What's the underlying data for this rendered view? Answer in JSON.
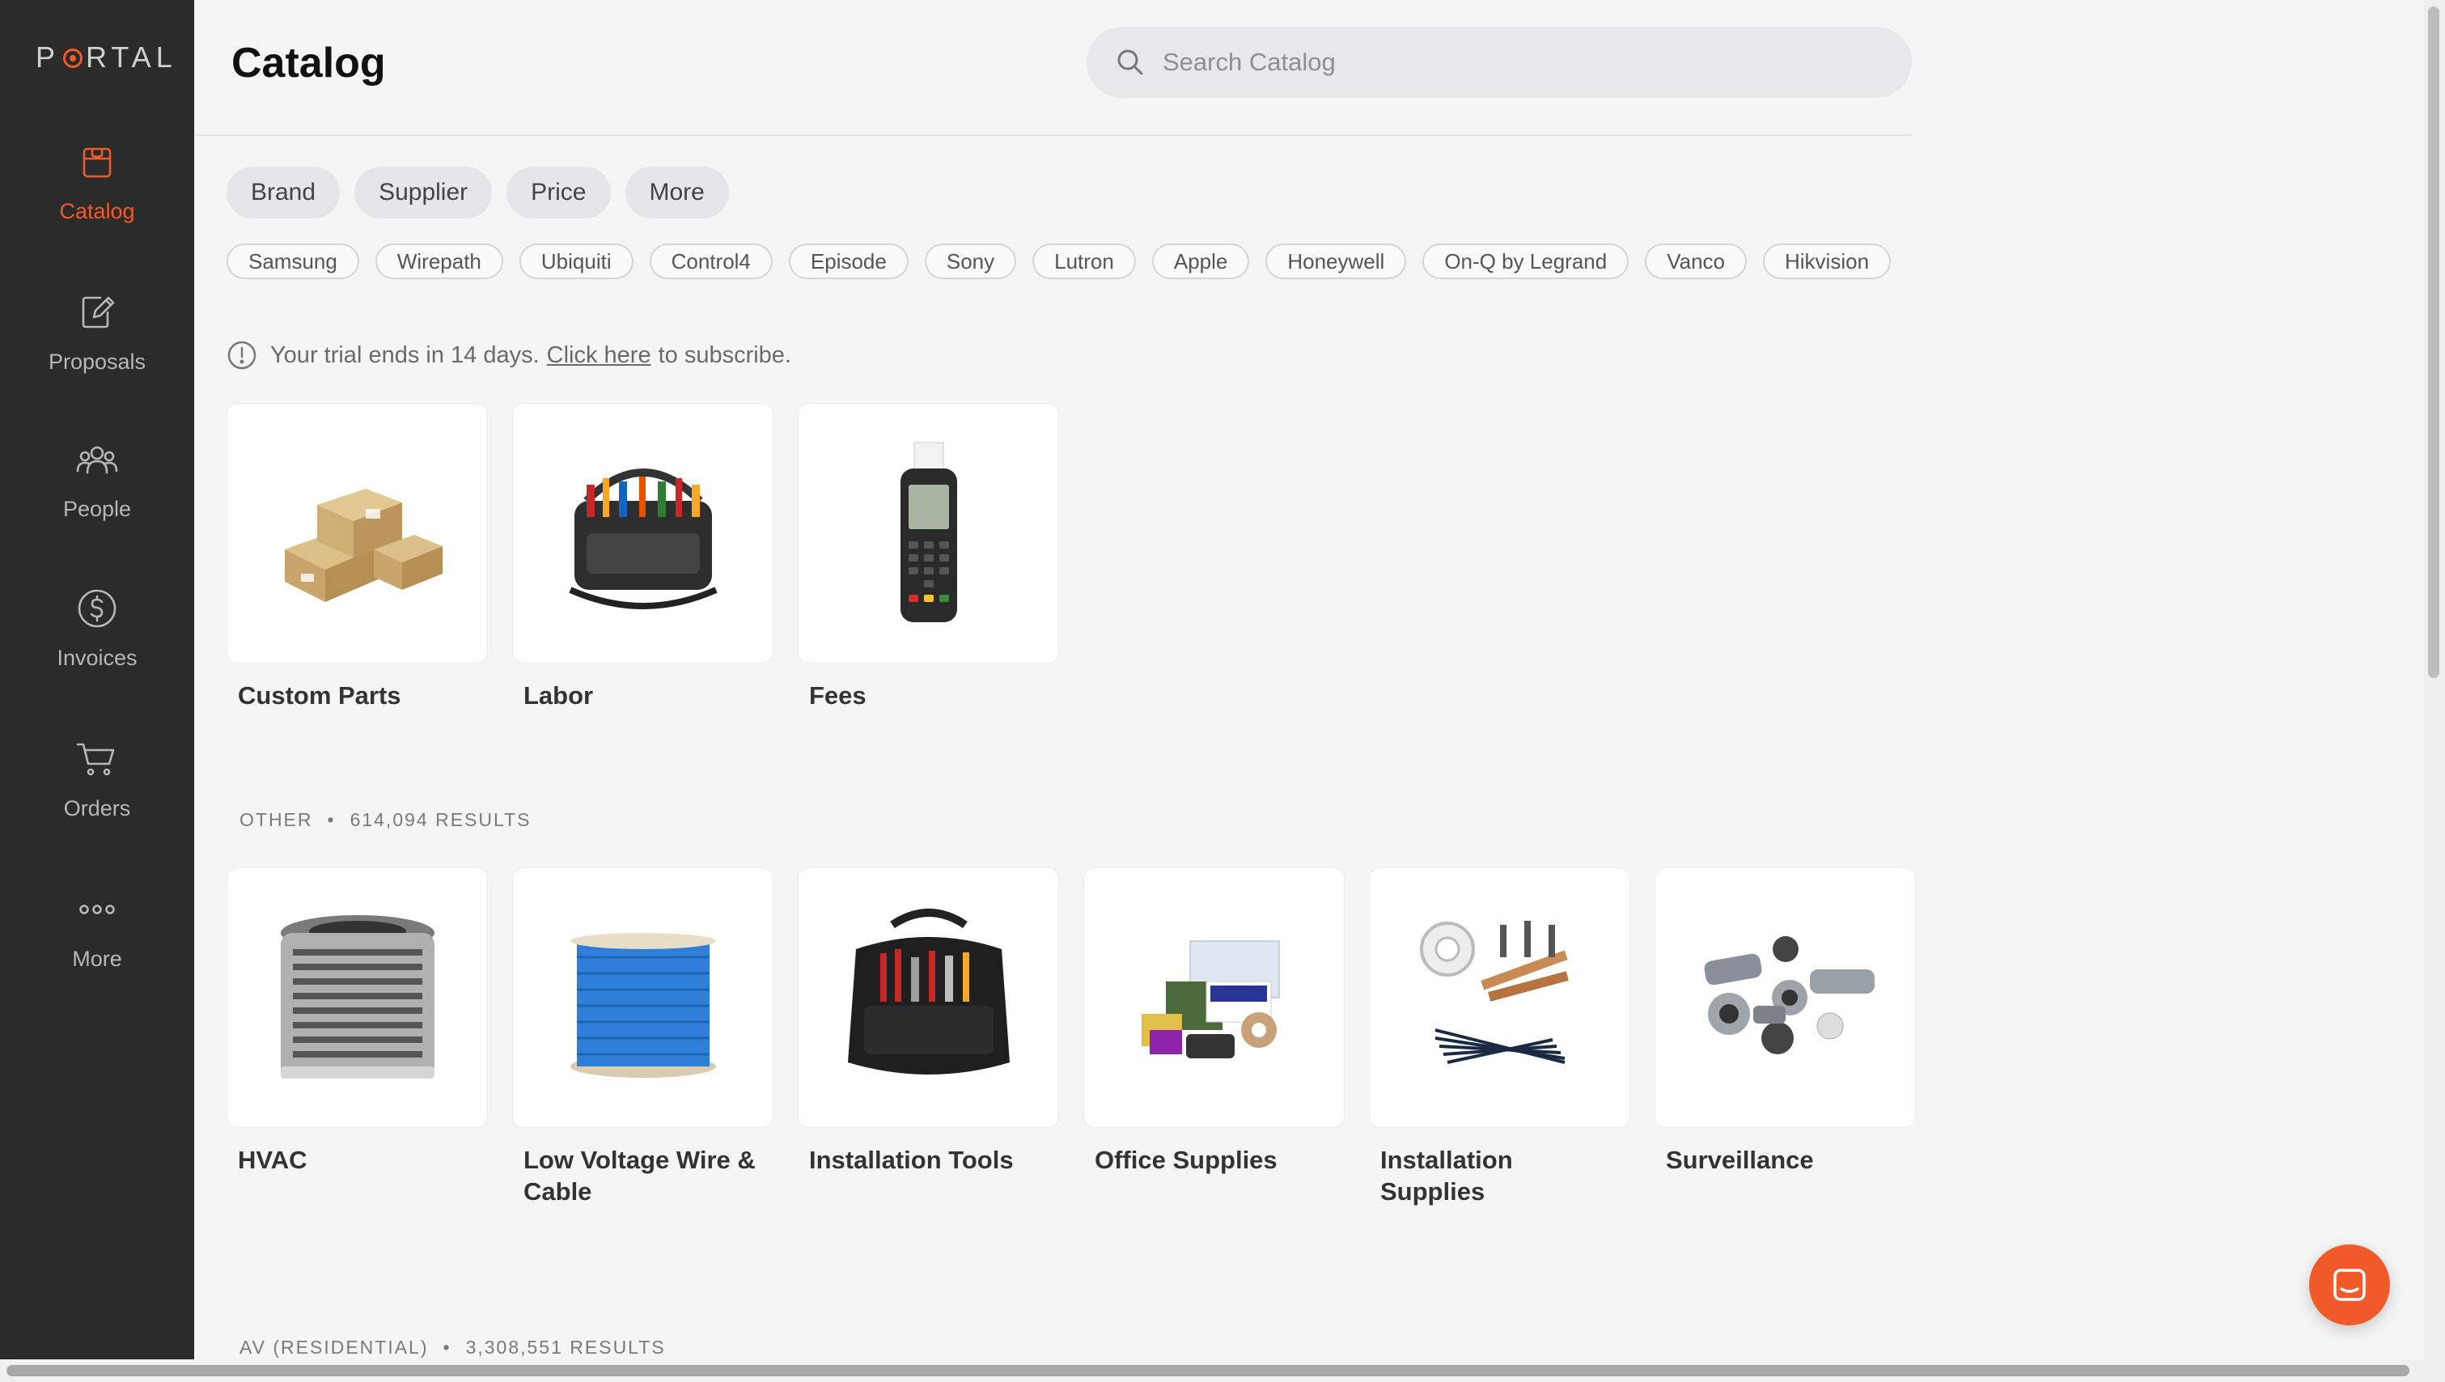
{
  "app": {
    "logo_text": "PORTAL"
  },
  "sidebar": {
    "items": [
      {
        "label": "Catalog",
        "icon": "box-icon",
        "active": true
      },
      {
        "label": "Proposals",
        "icon": "edit-document-icon"
      },
      {
        "label": "People",
        "icon": "people-icon"
      },
      {
        "label": "Invoices",
        "icon": "dollar-circle-icon"
      },
      {
        "label": "Orders",
        "icon": "cart-icon"
      },
      {
        "label": "More",
        "icon": "more-dots-icon"
      }
    ]
  },
  "header": {
    "title": "Catalog",
    "search_placeholder": "Search Catalog"
  },
  "filters": [
    "Brand",
    "Supplier",
    "Price",
    "More"
  ],
  "brands": [
    "Samsung",
    "Wirepath",
    "Ubiquiti",
    "Control4",
    "Episode",
    "Sony",
    "Lutron",
    "Apple",
    "Honeywell",
    "On-Q by Legrand",
    "Vanco",
    "Hikvision"
  ],
  "trial": {
    "before": "Your trial ends in 14 days.",
    "link": "Click here",
    "after": "to subscribe."
  },
  "featured": [
    {
      "name": "Custom Parts",
      "image": "boxes"
    },
    {
      "name": "Labor",
      "image": "tool-bag"
    },
    {
      "name": "Fees",
      "image": "card-terminal"
    }
  ],
  "sections": [
    {
      "label": "OTHER",
      "count": "614,094 RESULTS",
      "items": [
        {
          "name": "HVAC",
          "image": "ac-unit"
        },
        {
          "name": "Low Voltage Wire & Cable",
          "image": "cable-spool"
        },
        {
          "name": "Installation Tools",
          "image": "tool-backpack"
        },
        {
          "name": "Office Supplies",
          "image": "office-supplies"
        },
        {
          "name": "Installation Supplies",
          "image": "install-supplies"
        },
        {
          "name": "Surveillance",
          "image": "cameras"
        }
      ]
    },
    {
      "label": "AV (RESIDENTIAL)",
      "count": "3,308,551 RESULTS"
    }
  ],
  "colors": {
    "accent": "#f15a29",
    "sidebar_bg": "#2b2b2b",
    "page_bg": "#f5f5f5"
  }
}
